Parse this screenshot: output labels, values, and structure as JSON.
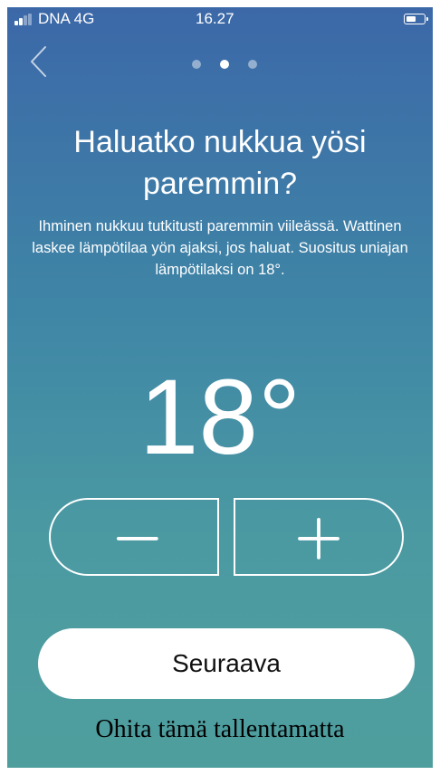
{
  "status_bar": {
    "carrier": "DNA 4G",
    "time": "16.27",
    "signal_bars_filled": 2,
    "signal_bars_total": 4,
    "battery_level": 0.5
  },
  "navigation": {
    "back_icon": "chevron-left-icon",
    "page_indicator": {
      "total": 3,
      "active_index": 1
    }
  },
  "content": {
    "title": "Haluatko nukkua yösi paremmin?",
    "description": "Ihminen nukkuu tutkitusti paremmin viileässä. Wattinen laskee lämpötilaa yön ajaksi, jos haluat. Suositus uniajan lämpötilaksi on 18°.",
    "temperature": "18°"
  },
  "stepper": {
    "decrease_icon": "minus-icon",
    "increase_icon": "plus-icon"
  },
  "actions": {
    "next_label": "Seuraava",
    "skip_label": "Ohita tämä tallentamatta"
  },
  "colors": {
    "gradient_top": "#3c68a8",
    "gradient_bottom": "#4f9e9e",
    "foreground": "#ffffff",
    "button_text": "#111111"
  }
}
